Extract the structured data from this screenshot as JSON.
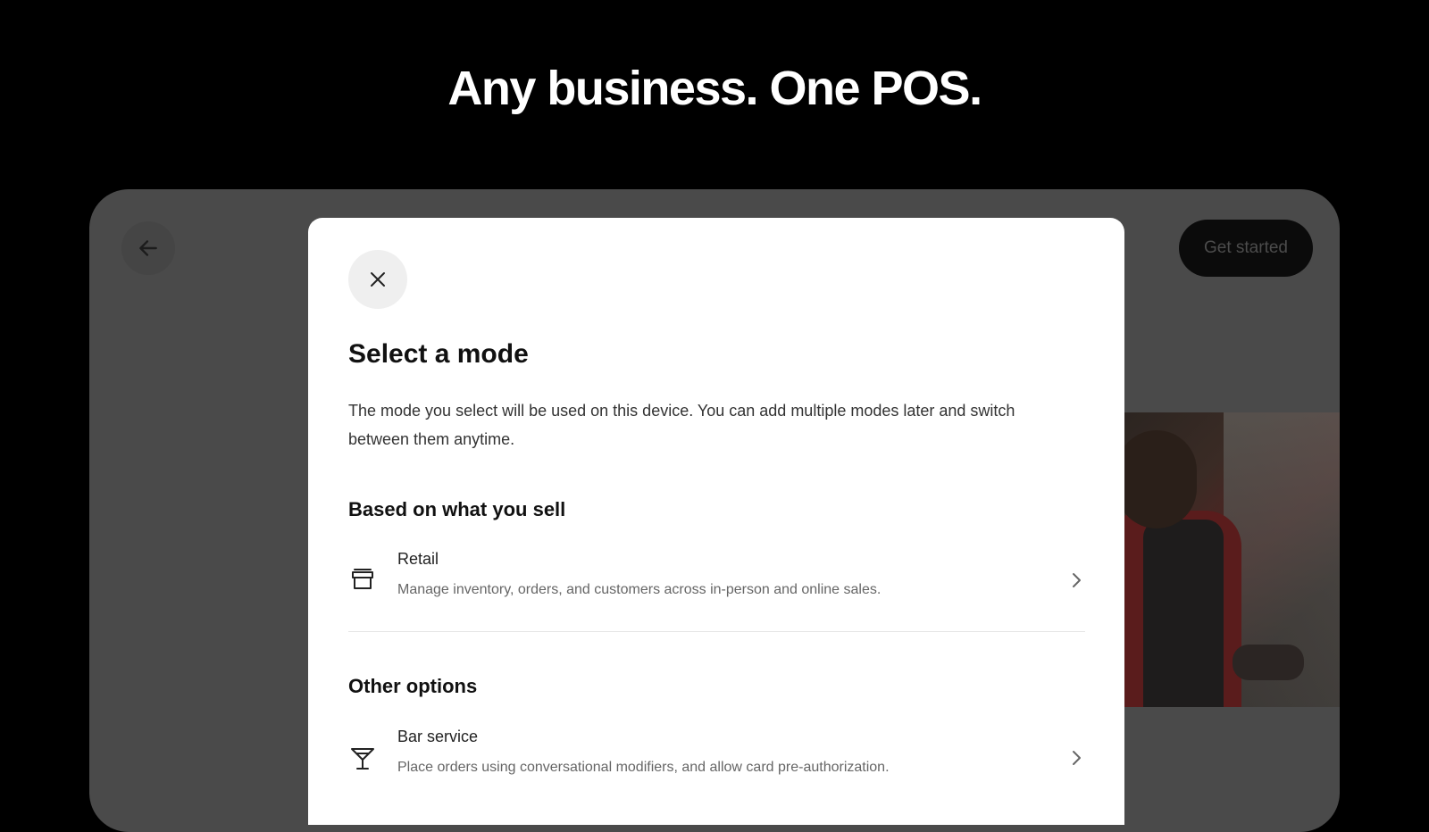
{
  "headline": "Any business. One POS.",
  "background_app": {
    "back_icon": "arrow-left-icon",
    "get_started_label": "Get started"
  },
  "modal": {
    "close_icon": "close-icon",
    "title": "Select a mode",
    "description": "The mode you select will be used on this device. You can add multiple modes later and switch between them anytime.",
    "sections": [
      {
        "title": "Based on what you sell",
        "options": [
          {
            "icon": "storefront-icon",
            "title": "Retail",
            "subtitle": "Manage inventory, orders, and customers across in-person and online sales."
          }
        ]
      },
      {
        "title": "Other options",
        "options": [
          {
            "icon": "cocktail-glass-icon",
            "title": "Bar service",
            "subtitle": "Place orders using conversational modifiers, and allow card pre-authorization."
          }
        ]
      }
    ]
  },
  "colors": {
    "page_background": "#000000",
    "device_background": "#4a4a4a",
    "modal_background": "#ffffff"
  }
}
